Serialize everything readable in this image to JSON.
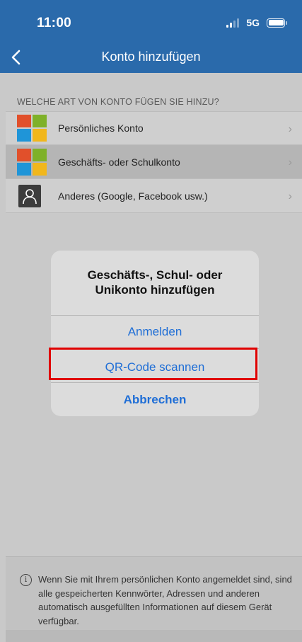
{
  "status_bar": {
    "time": "11:00",
    "network": "5G"
  },
  "nav": {
    "title": "Konto hinzufügen",
    "back_icon": "chevron-left-icon"
  },
  "section_header": "WELCHE ART VON KONTO FÜGEN SIE HINZU?",
  "accounts": [
    {
      "label": "Persönliches Konto",
      "icon": "microsoft-logo-icon",
      "selected": false
    },
    {
      "label": "Geschäfts- oder Schulkonto",
      "icon": "microsoft-logo-icon",
      "selected": true
    },
    {
      "label": "Anderes (Google, Facebook usw.)",
      "icon": "person-icon",
      "selected": false
    }
  ],
  "dialog": {
    "title": "Geschäfts-, Schul- oder Unikonto hinzufügen",
    "buttons": {
      "sign_in": "Anmelden",
      "scan_qr": "QR-Code scannen",
      "cancel": "Abbrechen"
    }
  },
  "footer": {
    "icon": "info-icon",
    "text": "Wenn Sie mit Ihrem persönlichen Konto angemeldet sind, sind alle gespeicherten Kennwörter, Adressen und anderen automatisch ausgefüllten Informationen auf diesem Gerät verfügbar."
  },
  "colors": {
    "header_bg": "#2a6aab",
    "link_blue": "#1f6ed6",
    "highlight_red": "#e00000",
    "ms_red": "#e1502b",
    "ms_green": "#7fb129",
    "ms_blue": "#1f95d8",
    "ms_yellow": "#f1b71c"
  }
}
